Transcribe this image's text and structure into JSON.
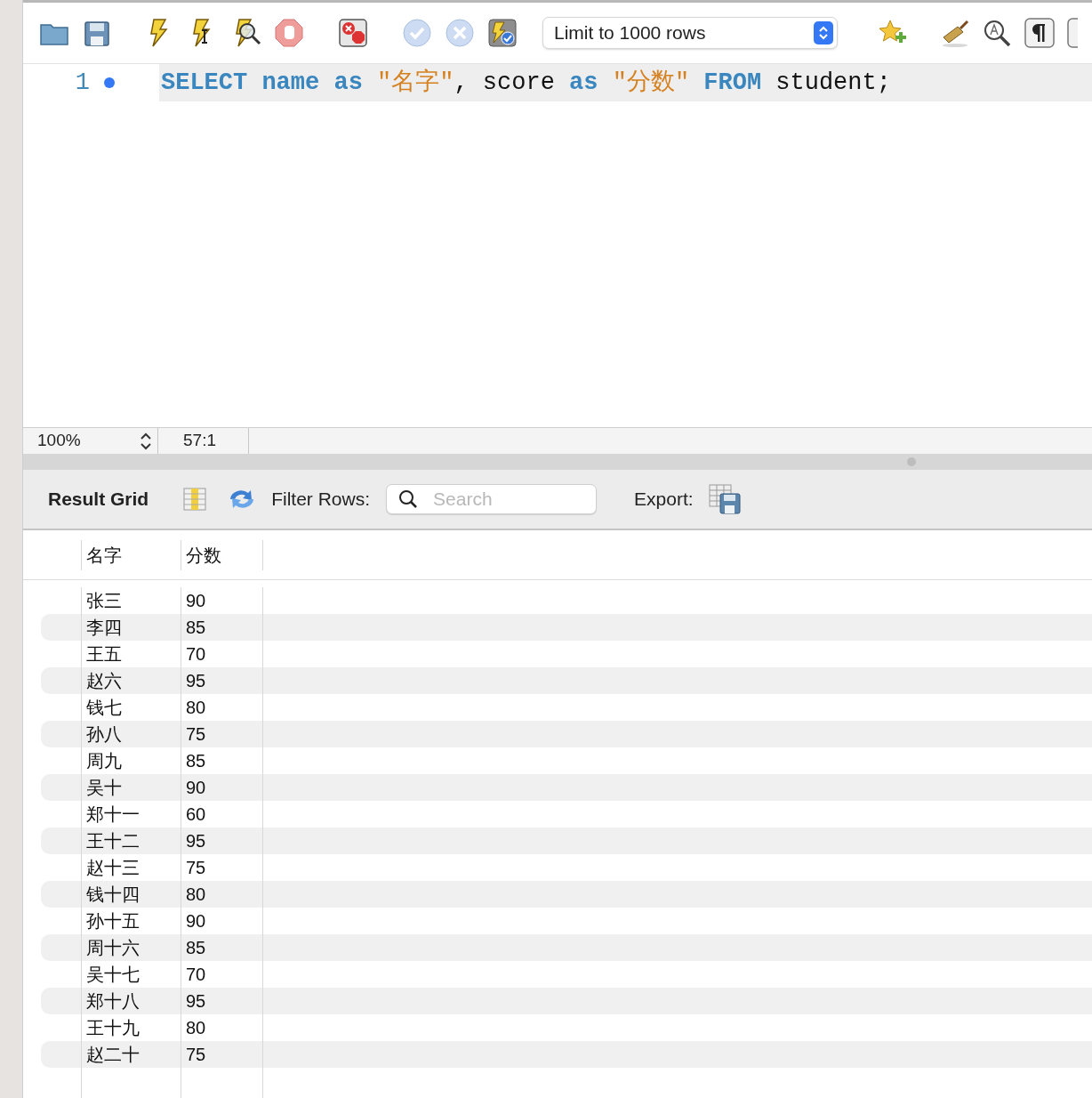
{
  "toolbar": {
    "limit_select": "Limit to 1000 rows"
  },
  "editor": {
    "lines": [
      {
        "number": "1",
        "active": true,
        "tokens": [
          {
            "text": "SELECT",
            "kind": "keyword"
          },
          {
            "text": "name",
            "kind": "keyword"
          },
          {
            "text": "as",
            "kind": "keyword"
          },
          {
            "text": "\"名字\"",
            "kind": "string"
          },
          {
            "text": ",",
            "kind": "punct"
          },
          {
            "text": "score",
            "kind": "plain"
          },
          {
            "text": "as",
            "kind": "keyword"
          },
          {
            "text": "\"分数\"",
            "kind": "string"
          },
          {
            "text": "FROM",
            "kind": "keyword"
          },
          {
            "text": "student",
            "kind": "plain"
          },
          {
            "text": ";",
            "kind": "punct"
          }
        ]
      }
    ]
  },
  "status_bar": {
    "zoom": "100%",
    "position": "57:1"
  },
  "result_toolbar": {
    "title": "Result Grid",
    "filter_label": "Filter Rows:",
    "search": {
      "placeholder": "Search"
    },
    "export_label": "Export:"
  },
  "grid": {
    "columns": [
      "名字",
      "分数"
    ],
    "rows": [
      [
        "张三",
        "90"
      ],
      [
        "李四",
        "85"
      ],
      [
        "王五",
        "70"
      ],
      [
        "赵六",
        "95"
      ],
      [
        "钱七",
        "80"
      ],
      [
        "孙八",
        "75"
      ],
      [
        "周九",
        "85"
      ],
      [
        "吴十",
        "90"
      ],
      [
        "郑十一",
        "60"
      ],
      [
        "王十二",
        "95"
      ],
      [
        "赵十三",
        "75"
      ],
      [
        "钱十四",
        "80"
      ],
      [
        "孙十五",
        "90"
      ],
      [
        "周十六",
        "85"
      ],
      [
        "吴十七",
        "70"
      ],
      [
        "郑十八",
        "95"
      ],
      [
        "王十九",
        "80"
      ],
      [
        "赵二十",
        "75"
      ]
    ]
  }
}
